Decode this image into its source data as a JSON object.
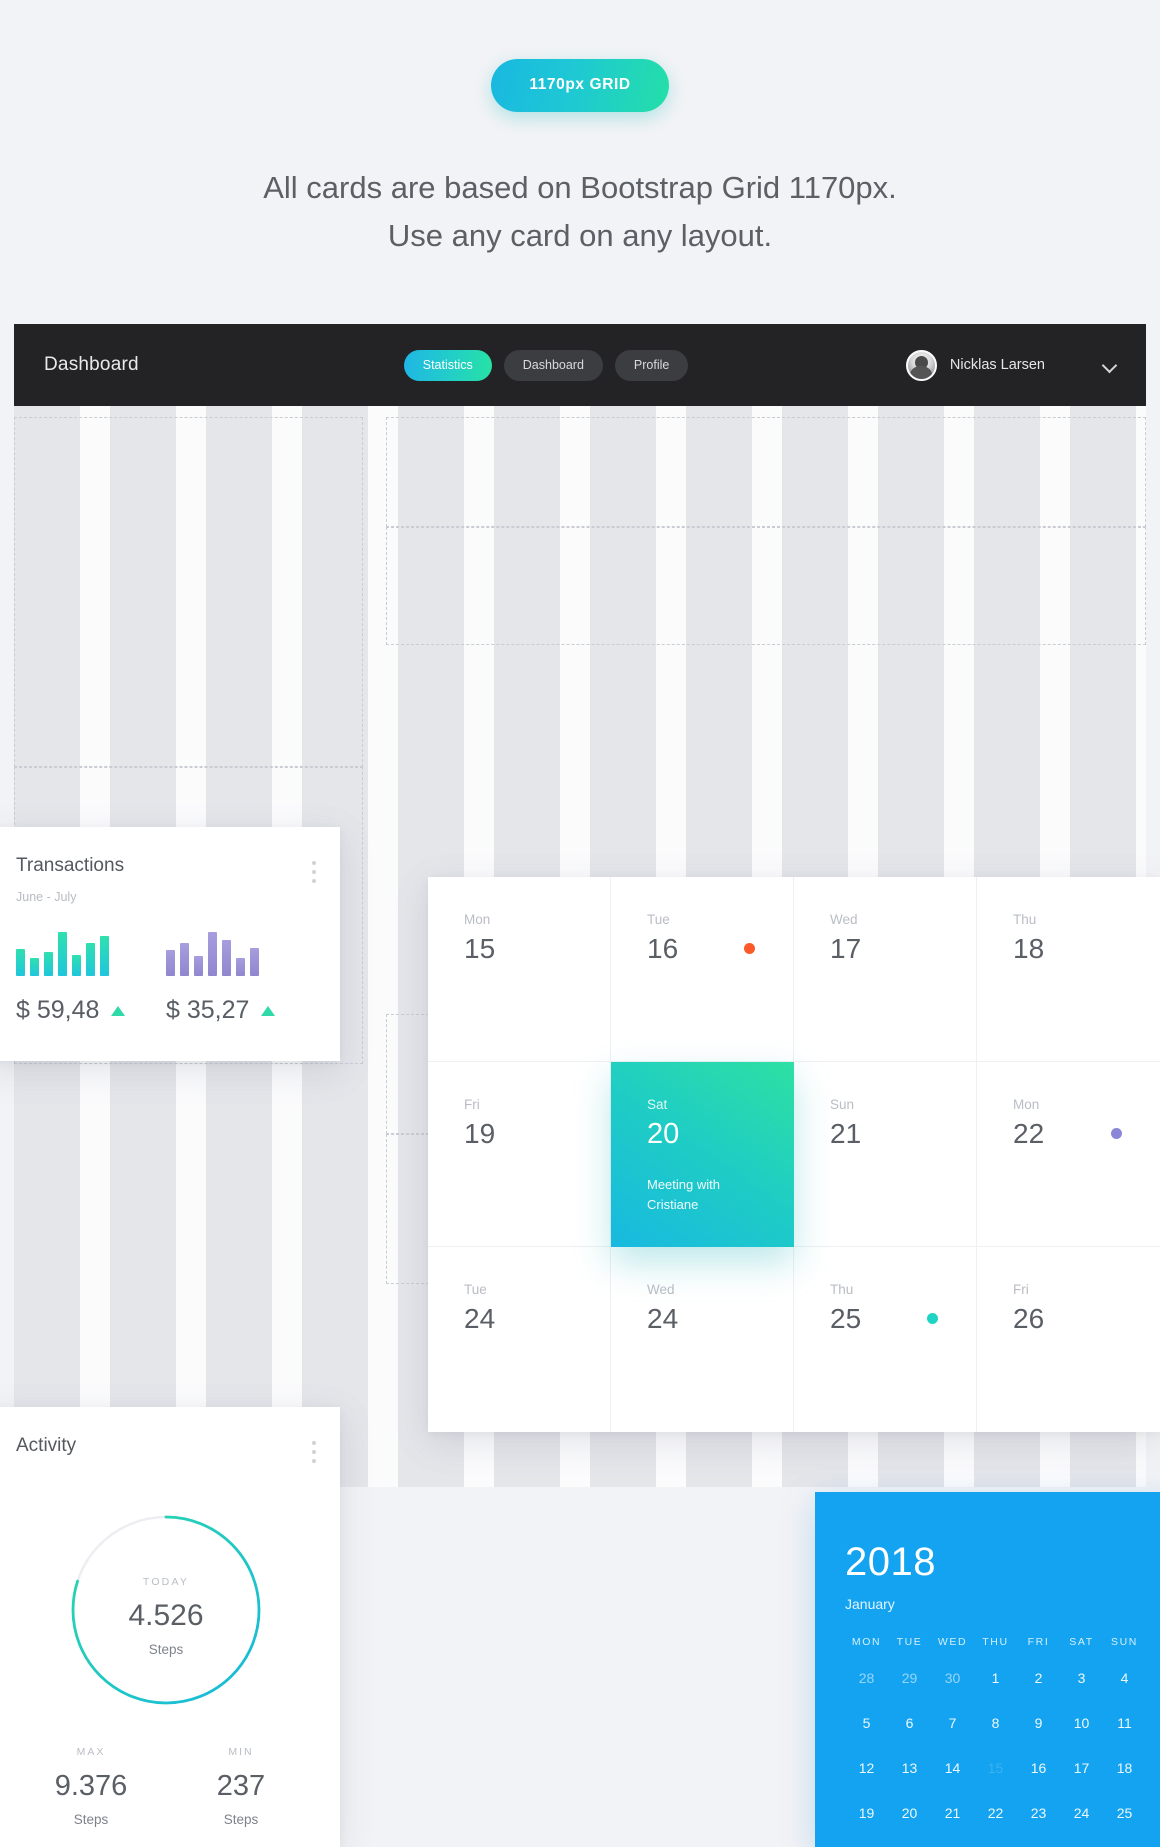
{
  "hero": {
    "badge": "1170px GRID",
    "headline_line1": "All cards are based on Bootstrap Grid 1170px.",
    "headline_line2": "Use any card on any layout."
  },
  "navbar": {
    "brand": "Dashboard",
    "pills": [
      {
        "label": "Statistics",
        "active": true
      },
      {
        "label": "Dashboard",
        "active": false
      },
      {
        "label": "Profile",
        "active": false
      }
    ],
    "username": "Nicklas Larsen",
    "chevron_icon": "chevron-down-icon",
    "accent_gradient_from": "#1fb6e5",
    "accent_gradient_to": "#27e2a4",
    "background": "#232325"
  },
  "transactions": {
    "title": "Transactions",
    "subtitle": "June - July",
    "menu_icon": "kebab-menu-icon",
    "groups": [
      {
        "value": "$ 59,48",
        "trend": "up",
        "color": "#23cfc3",
        "bars": [
          62,
          40,
          55,
          100,
          48,
          76,
          92
        ]
      },
      {
        "value": "$ 35,27",
        "trend": "up",
        "color": "#9b92d8",
        "bars": [
          58,
          76,
          45,
          100,
          82,
          42,
          64
        ]
      }
    ]
  },
  "week_calendar": {
    "days": [
      {
        "name": "Mon",
        "num": "15",
        "dot": null,
        "note": null,
        "featured": false
      },
      {
        "name": "Tue",
        "num": "16",
        "dot": "#fc5a2b",
        "note": null,
        "featured": false
      },
      {
        "name": "Wed",
        "num": "17",
        "dot": null,
        "note": null,
        "featured": false
      },
      {
        "name": "Thu",
        "num": "18",
        "dot": null,
        "note": null,
        "featured": false
      },
      {
        "name": "Fri",
        "num": "19",
        "dot": null,
        "note": null,
        "featured": false
      },
      {
        "name": "Sat",
        "num": "20",
        "dot": null,
        "note": "Meeting with Cristiane",
        "featured": true
      },
      {
        "name": "Sun",
        "num": "21",
        "dot": null,
        "note": null,
        "featured": false
      },
      {
        "name": "Mon",
        "num": "22",
        "dot": "#8b86d6",
        "note": null,
        "featured": false
      },
      {
        "name": "Tue",
        "num": "24",
        "dot": null,
        "note": null,
        "featured": false
      },
      {
        "name": "Wed",
        "num": "24",
        "dot": null,
        "note": null,
        "featured": false
      },
      {
        "name": "Thu",
        "num": "25",
        "dot": "#1fd4c4",
        "note": null,
        "featured": false
      },
      {
        "name": "Fri",
        "num": "26",
        "dot": null,
        "note": null,
        "featured": false
      }
    ]
  },
  "activity": {
    "title": "Activity",
    "menu_icon": "kebab-menu-icon",
    "ring": {
      "label": "TODAY",
      "value": "4.526",
      "unit": "Steps",
      "percent": 80,
      "track_color": "#eceef1",
      "gradient_from": "#2ad8a8",
      "gradient_to": "#16b9dd"
    },
    "stats": [
      {
        "label": "MAX",
        "value": "9.376",
        "unit": "Steps"
      },
      {
        "label": "MIN",
        "value": "237",
        "unit": "Steps"
      }
    ]
  },
  "month_calendar": {
    "year": "2018",
    "month": "January",
    "background": "#14a3f0",
    "weekdays": [
      "MON",
      "TUE",
      "WED",
      "THU",
      "FRI",
      "SAT",
      "SUN"
    ],
    "weeks": [
      [
        {
          "d": "28",
          "muted": true
        },
        {
          "d": "29",
          "muted": true
        },
        {
          "d": "30",
          "muted": true
        },
        {
          "d": "1",
          "muted": false
        },
        {
          "d": "2",
          "muted": false
        },
        {
          "d": "3",
          "muted": false
        },
        {
          "d": "4",
          "muted": false
        }
      ],
      [
        {
          "d": "5",
          "muted": false
        },
        {
          "d": "6",
          "muted": false
        },
        {
          "d": "7",
          "muted": false
        },
        {
          "d": "8",
          "muted": false
        },
        {
          "d": "9",
          "muted": false
        },
        {
          "d": "10",
          "muted": false
        },
        {
          "d": "11",
          "muted": false
        }
      ],
      [
        {
          "d": "12",
          "muted": false
        },
        {
          "d": "13",
          "muted": false
        },
        {
          "d": "14",
          "muted": false
        },
        {
          "d": "15",
          "muted": false,
          "today": true
        },
        {
          "d": "16",
          "muted": false
        },
        {
          "d": "17",
          "muted": false
        },
        {
          "d": "18",
          "muted": false
        }
      ],
      [
        {
          "d": "19",
          "muted": false
        },
        {
          "d": "20",
          "muted": false
        },
        {
          "d": "21",
          "muted": false
        },
        {
          "d": "22",
          "muted": false
        },
        {
          "d": "23",
          "muted": false
        },
        {
          "d": "24",
          "muted": false
        },
        {
          "d": "25",
          "muted": false
        }
      ]
    ]
  }
}
